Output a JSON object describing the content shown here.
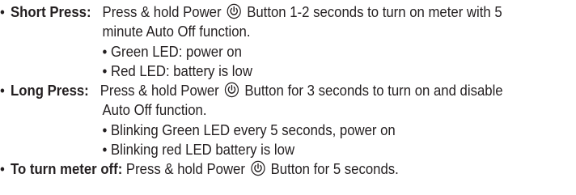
{
  "sections": [
    {
      "term": "Short Press:",
      "text_before_icon": "Press & hold Power",
      "text_after_icon": "Button 1-2 seconds  to turn on meter with 5",
      "continuation": "minute Auto Off function.",
      "items": [
        "Green LED: power on",
        "Red LED: battery is low"
      ]
    },
    {
      "term": "Long Press:",
      "text_before_icon": "Press & hold Power",
      "text_after_icon": "Button for 3 seconds to turn on and disable",
      "continuation": "Auto Off function.",
      "items": [
        "Blinking Green LED every 5 seconds, power on",
        "Blinking red LED battery is low"
      ]
    },
    {
      "term": "To turn meter off:",
      "text_before_icon": "Press & hold Power",
      "text_after_icon": "Button for 5 seconds."
    }
  ],
  "bullet_char": "•",
  "icons": {
    "power": "power-icon"
  },
  "colors": {
    "text": "#231f20"
  }
}
